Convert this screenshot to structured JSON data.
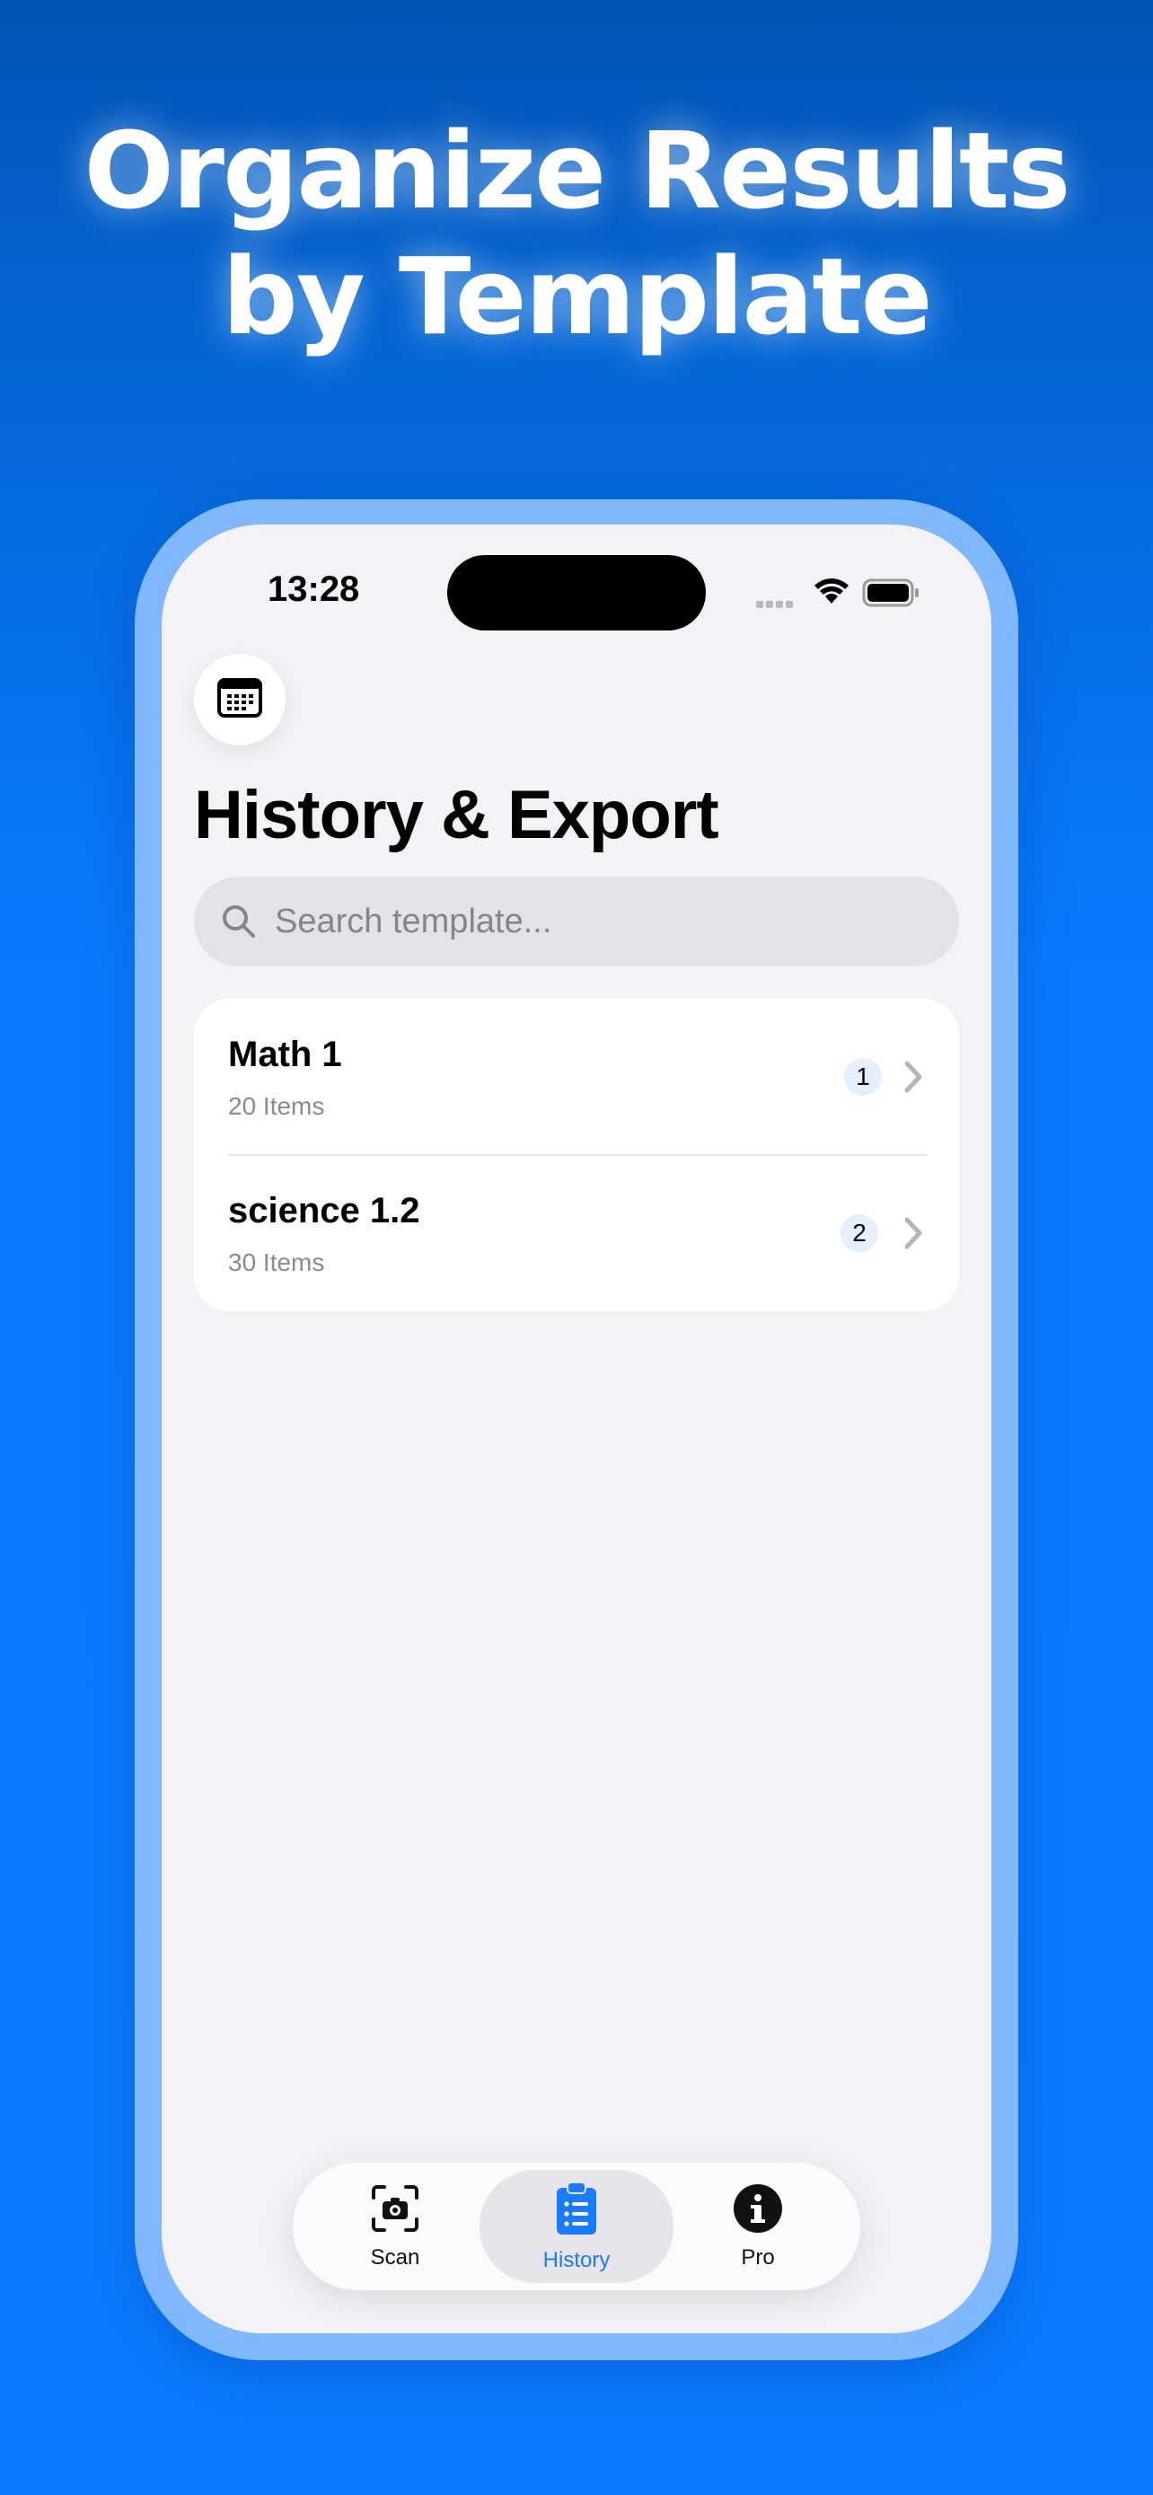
{
  "promo": {
    "headline_line1": "Organize Results",
    "headline_line2": "by Template"
  },
  "status_bar": {
    "time": "13:28"
  },
  "header": {
    "title": "History & Export"
  },
  "search": {
    "placeholder": "Search template..."
  },
  "templates": [
    {
      "name": "Math 1",
      "subtitle": "20 Items",
      "count": "1"
    },
    {
      "name": "science 1.2",
      "subtitle": "30 Items",
      "count": "2"
    }
  ],
  "tabs": [
    {
      "label": "Scan",
      "icon": "camera-viewfinder-icon",
      "active": false
    },
    {
      "label": "History",
      "icon": "clipboard-list-icon",
      "active": true
    },
    {
      "label": "Pro",
      "icon": "info-circle-icon",
      "active": false
    }
  ],
  "colors": {
    "accent": "#1a7bff",
    "background_blue": "#0b7cff",
    "screen_bg": "#f2f2f7"
  }
}
